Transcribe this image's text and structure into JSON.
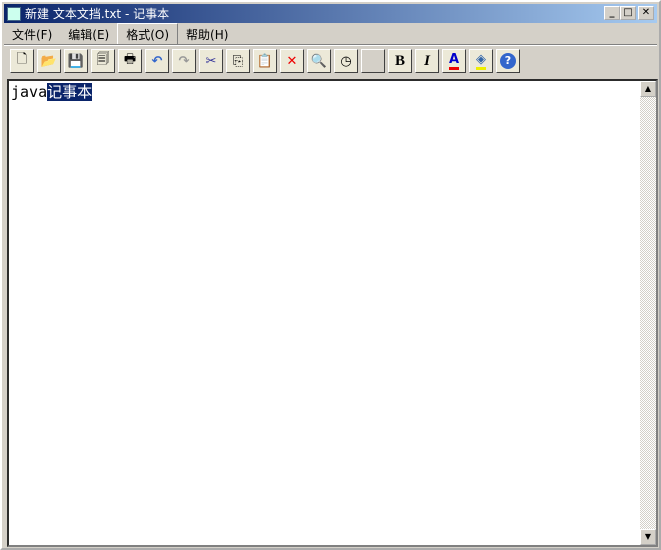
{
  "window": {
    "title": "新建 文本文挡.txt - 记事本",
    "minimize": "_",
    "maximize": "□",
    "close": "✕"
  },
  "menu": [
    {
      "label": "文件(F)"
    },
    {
      "label": "编辑(E)"
    },
    {
      "label": "格式(O)"
    },
    {
      "label": "帮助(H)"
    }
  ],
  "toolbar": [
    {
      "name": "new",
      "glyph": "🗋"
    },
    {
      "name": "open",
      "glyph": "📂"
    },
    {
      "name": "save",
      "glyph": "💾"
    },
    {
      "name": "save-all",
      "glyph": "🗐"
    },
    {
      "name": "print",
      "glyph": "🖶"
    },
    {
      "name": "undo",
      "glyph": "↶"
    },
    {
      "name": "redo",
      "glyph": "↷"
    },
    {
      "name": "cut",
      "glyph": "✂"
    },
    {
      "name": "copy",
      "glyph": "⎘"
    },
    {
      "name": "paste",
      "glyph": "📋"
    },
    {
      "name": "delete",
      "glyph": "✕"
    },
    {
      "name": "find",
      "glyph": "🔍"
    },
    {
      "name": "time",
      "glyph": "◷"
    },
    {
      "name": "blank",
      "glyph": ""
    },
    {
      "name": "bold",
      "glyph": "B"
    },
    {
      "name": "italic",
      "glyph": "I"
    },
    {
      "name": "font-color",
      "glyph": "A"
    },
    {
      "name": "fill-color",
      "glyph": "◈"
    },
    {
      "name": "help",
      "glyph": "?"
    }
  ],
  "editor": {
    "text_plain": "java",
    "text_selected": "记事本"
  },
  "colors": {
    "selection": "#0a246a",
    "accent": "#0a246a"
  }
}
